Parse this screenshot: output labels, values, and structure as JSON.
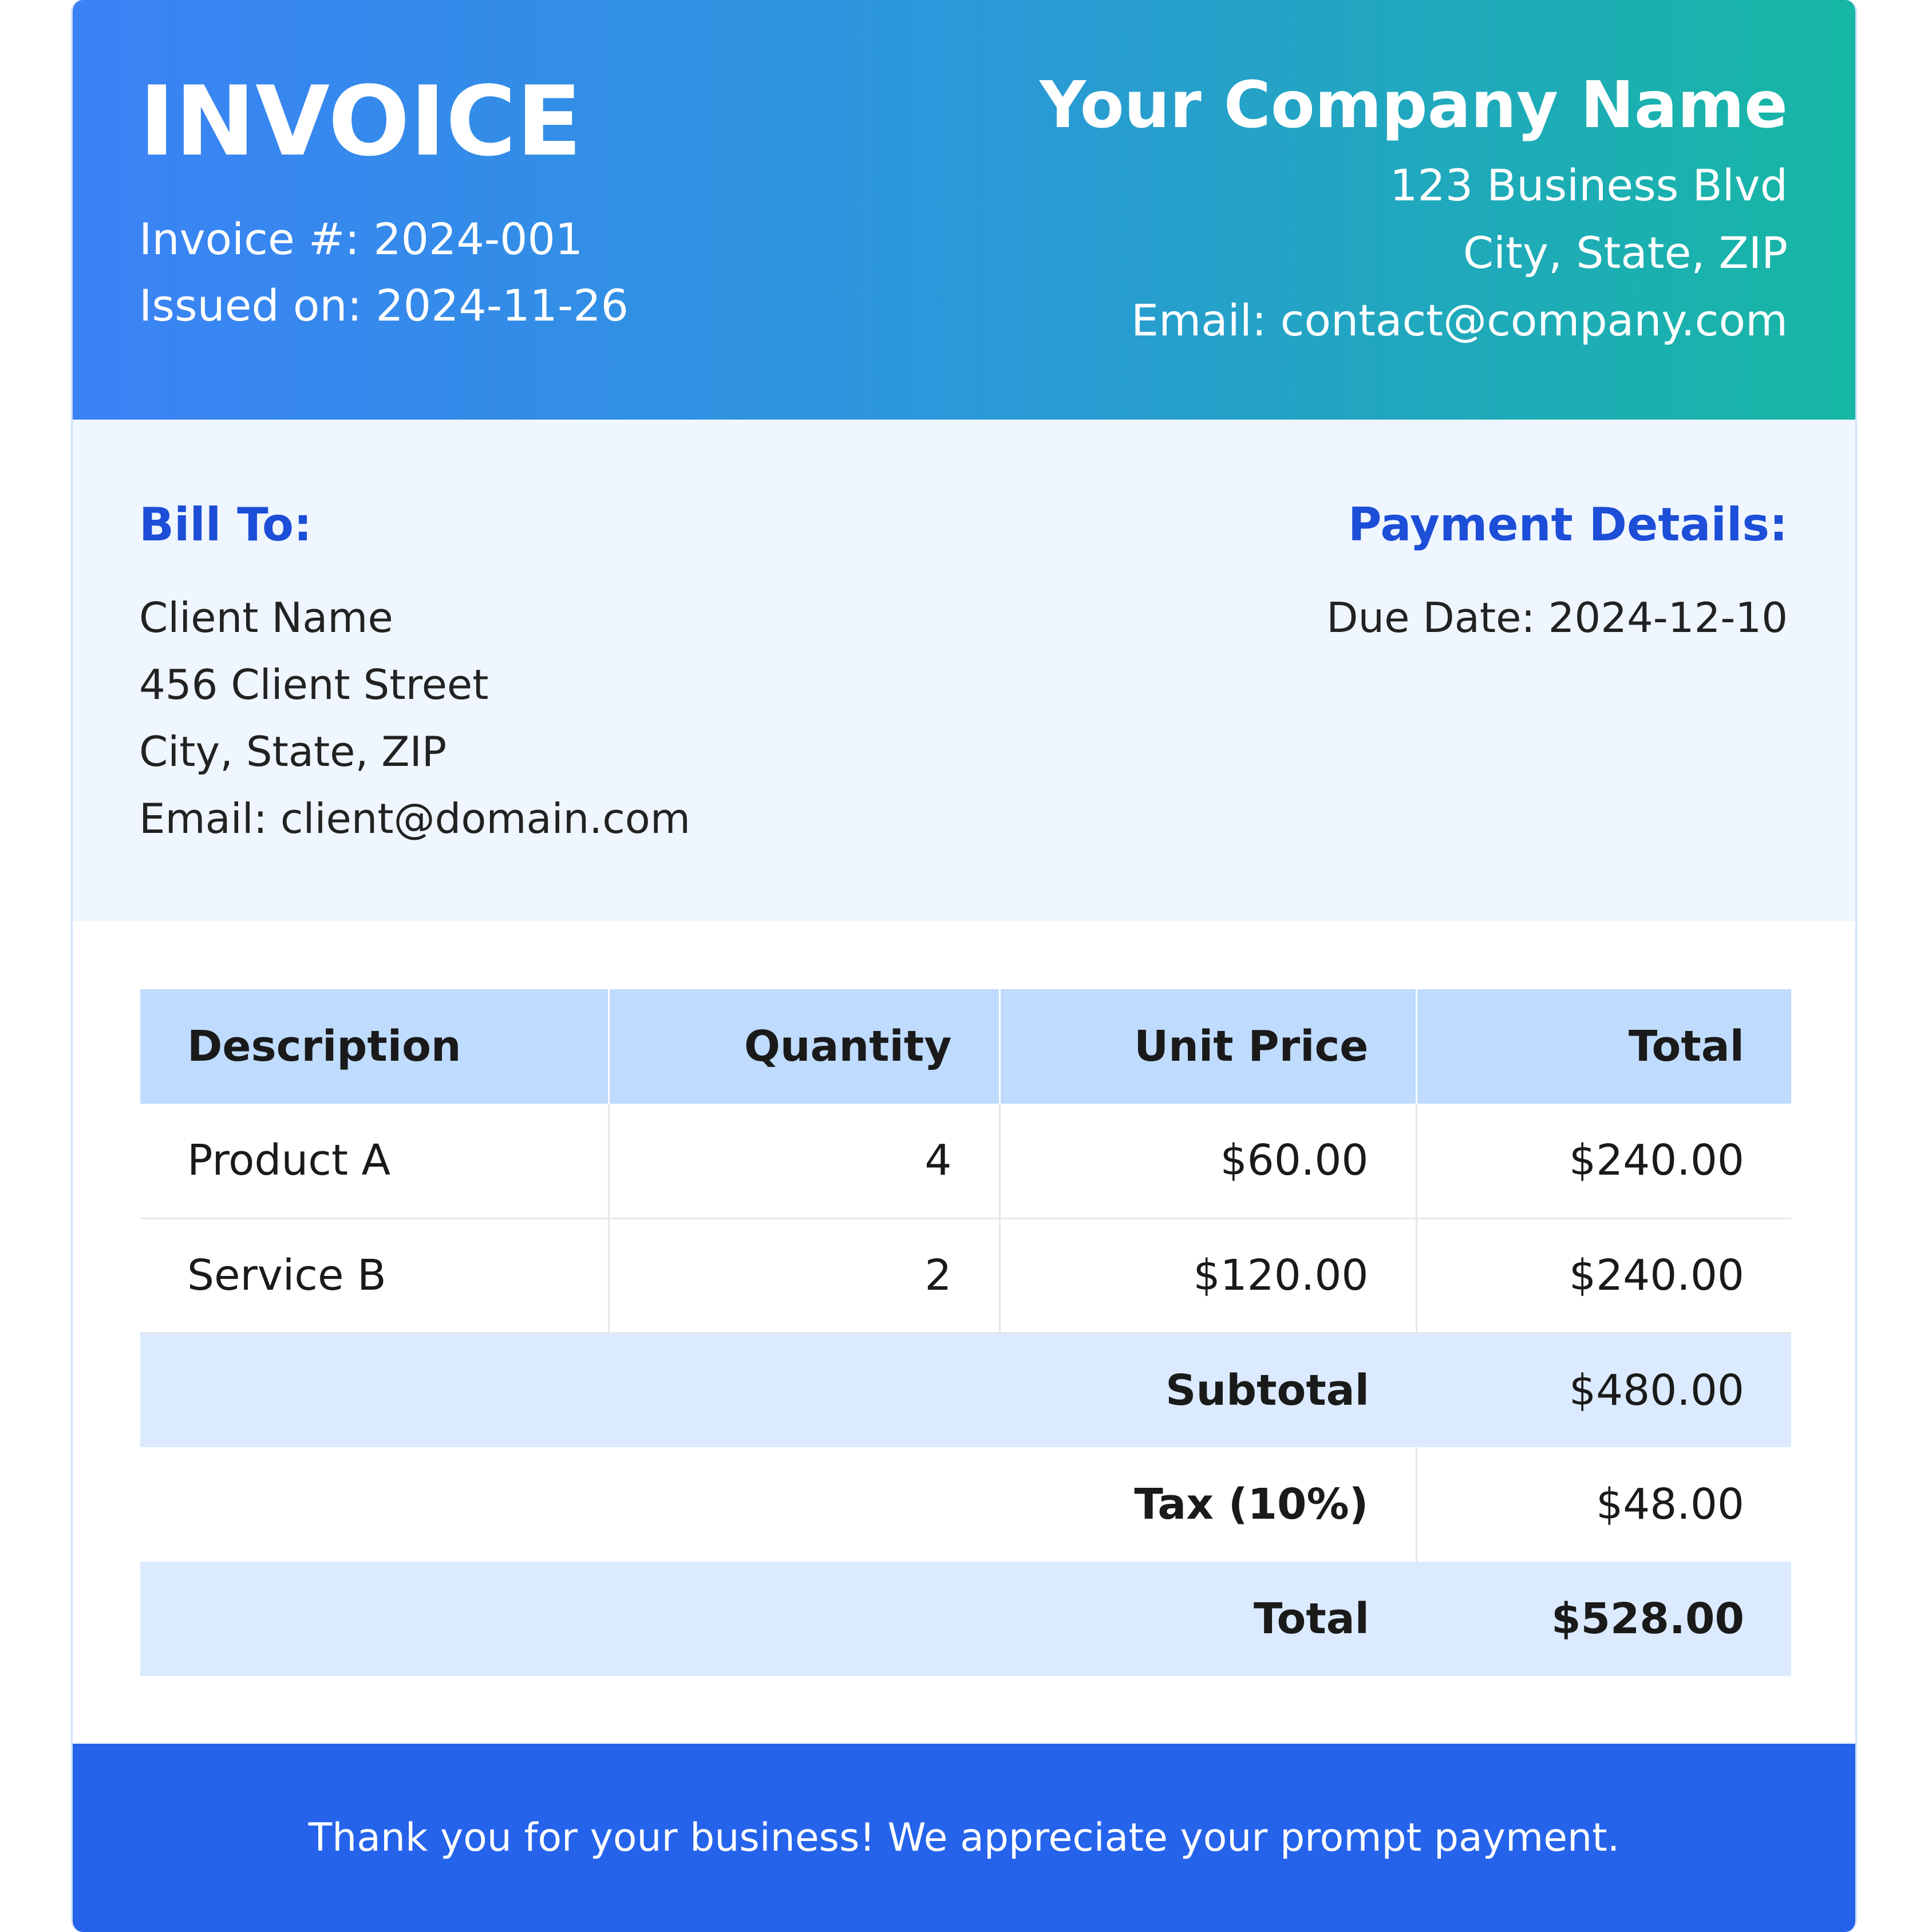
{
  "header": {
    "title": "INVOICE",
    "invoice_number": "Invoice #: 2024-001",
    "issued_on": "Issued on: 2024-11-26",
    "company_name": "Your Company Name",
    "company_address": "123 Business Blvd",
    "company_city": "City, State, ZIP",
    "company_email": "Email: contact@company.com"
  },
  "bill_to": {
    "heading": "Bill To:",
    "name": "Client Name",
    "street": "456 Client Street",
    "city": "City, State, ZIP",
    "email": "Email: client@domain.com"
  },
  "payment": {
    "heading": "Payment Details:",
    "due_date": "Due Date: 2024-12-10"
  },
  "table": {
    "columns": [
      "Description",
      "Quantity",
      "Unit Price",
      "Total"
    ],
    "rows": [
      {
        "description": "Product A",
        "quantity": "4",
        "unit_price": "$60.00",
        "total": "$240.00"
      },
      {
        "description": "Service B",
        "quantity": "2",
        "unit_price": "$120.00",
        "total": "$240.00"
      }
    ],
    "summary": {
      "subtotal_label": "Subtotal",
      "subtotal_value": "$480.00",
      "tax_label": "Tax (10%)",
      "tax_value": "$48.00",
      "total_label": "Total",
      "total_value": "$528.00"
    }
  },
  "footer": {
    "message": "Thank you for your business! We appreciate your prompt payment."
  },
  "colors": {
    "header_gradient_start": "#3b82f6",
    "header_gradient_end": "#16b7a4",
    "accent_heading": "#1d4ed8",
    "info_background": "#eff6ff",
    "table_header": "#bfdbfe",
    "summary_shade": "#dbeafe",
    "footer_background": "#2563eb"
  }
}
